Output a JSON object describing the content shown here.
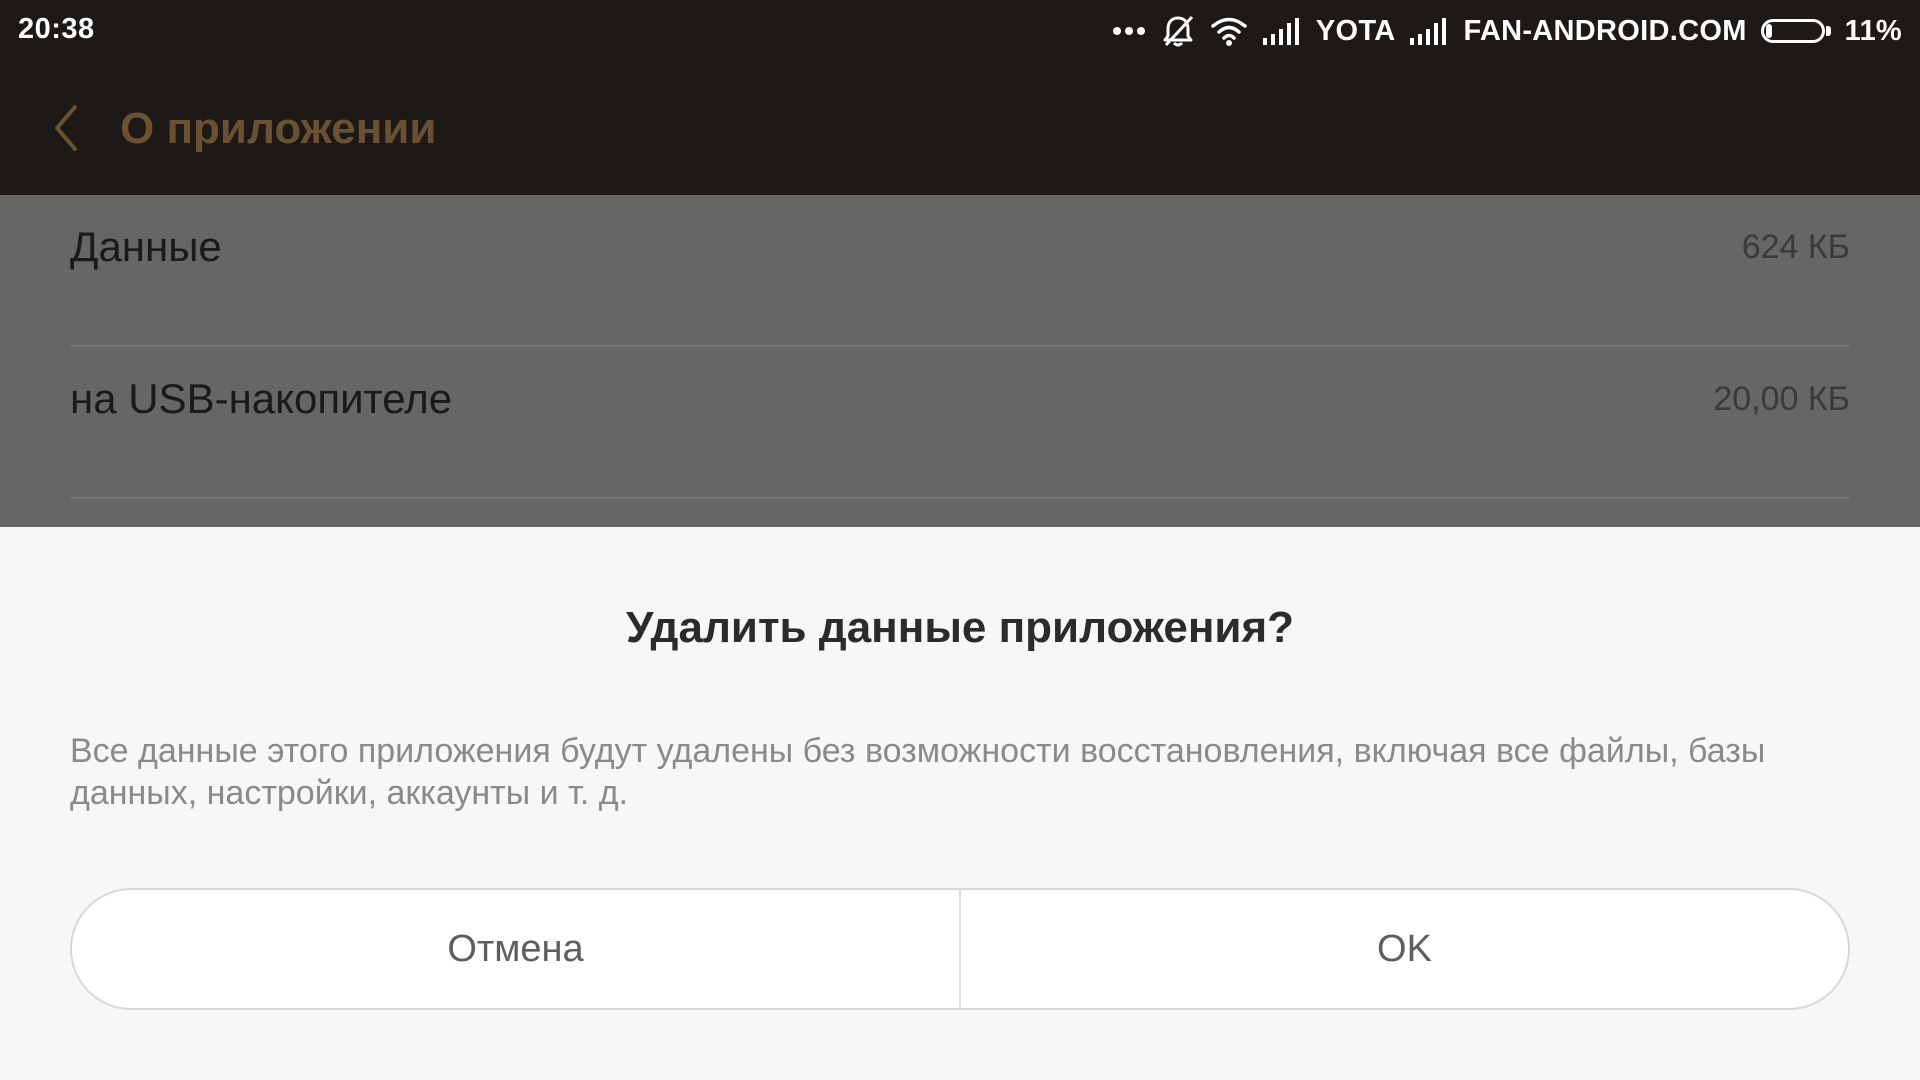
{
  "status_bar": {
    "time": "20:38",
    "carrier": "YOTA",
    "operator_text": "FAN-ANDROID.COM",
    "battery_percent": "11%",
    "battery_level": 0.11,
    "icons": [
      "more-dots-icon",
      "alarm-off-icon",
      "wifi-icon",
      "signal-icon",
      "signal-icon"
    ]
  },
  "header": {
    "title": "О приложении",
    "back_icon": "chevron-left-icon",
    "title_color": "#6b5131"
  },
  "storage": {
    "rows": [
      {
        "label": "Данные",
        "value": "624 КБ"
      },
      {
        "label": "на USB-накопителе",
        "value": "20,00 КБ"
      }
    ]
  },
  "dialog": {
    "title": "Удалить данные приложения?",
    "message": "Все данные этого приложения будут удалены без возможности восстановления, включая все файлы, базы данных, настройки, аккаунты и т. д.",
    "cancel_label": "Отмена",
    "ok_label": "OK"
  }
}
